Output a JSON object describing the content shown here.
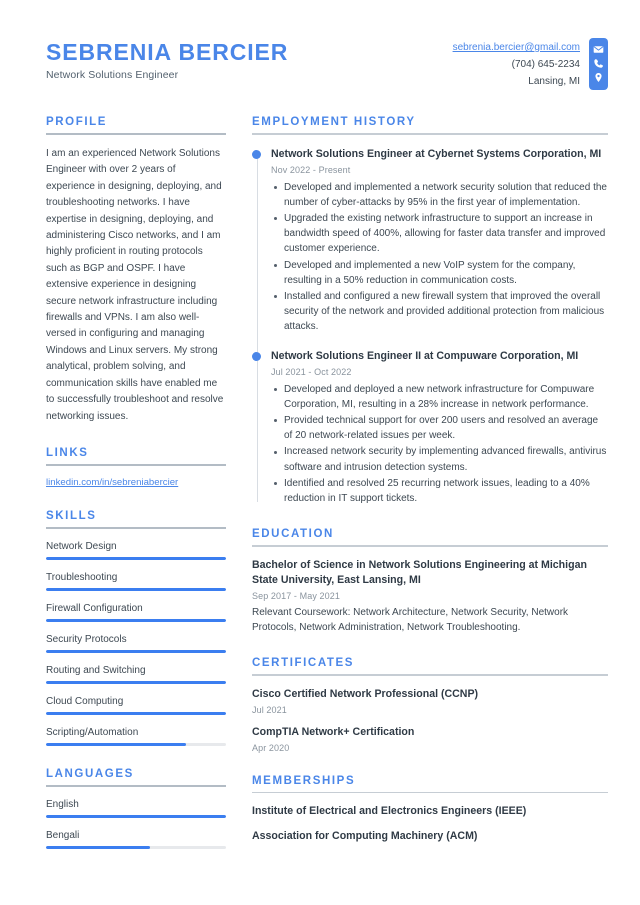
{
  "header": {
    "full_name": "SEBRENIA BERCIER",
    "job_title": "Network Solutions Engineer",
    "email": "sebrenia.bercier@gmail.com",
    "phone": "(704) 645-2234",
    "location": "Lansing, MI",
    "icons": [
      "envelope-icon",
      "phone-icon",
      "map-pin-icon"
    ],
    "accent_color": "#4a86e8"
  },
  "sidebar": {
    "profile": {
      "title": "Profile",
      "text": "I am an experienced Network Solutions Engineer with over 2 years of experience in designing, deploying, and troubleshooting networks. I have expertise in designing, deploying, and administering Cisco networks, and I am highly proficient in routing protocols such as BGP and OSPF. I have extensive experience in designing secure network infrastructure including firewalls and VPNs. I am also well-versed in configuring and managing Windows and Linux servers. My strong analytical, problem solving, and communication skills have enabled me to successfully troubleshoot and resolve networking issues."
    },
    "links": {
      "title": "Links",
      "items": [
        {
          "label": "linkedin.com/in/sebreniabercier"
        }
      ]
    },
    "skills": {
      "title": "Skills",
      "items": [
        {
          "label": "Network Design",
          "level": 100
        },
        {
          "label": "Troubleshooting",
          "level": 100
        },
        {
          "label": "Firewall Configuration",
          "level": 100
        },
        {
          "label": "Security Protocols",
          "level": 100
        },
        {
          "label": "Routing and Switching",
          "level": 100
        },
        {
          "label": "Cloud Computing",
          "level": 100
        },
        {
          "label": "Scripting/Automation",
          "level": 78
        }
      ]
    },
    "languages": {
      "title": "Languages",
      "items": [
        {
          "label": "English",
          "level": 100
        },
        {
          "label": "Bengali",
          "level": 58
        }
      ]
    }
  },
  "main": {
    "employment": {
      "title": "Employment History",
      "items": [
        {
          "title": "Network Solutions Engineer at Cybernet Systems Corporation, MI",
          "date": "Nov 2022 - Present",
          "bullets": [
            "Developed and implemented a network security solution that reduced the number of cyber-attacks by 95% in the first year of implementation.",
            "Upgraded the existing network infrastructure to support an increase in bandwidth speed of 400%, allowing for faster data transfer and improved customer experience.",
            "Developed and implemented a new VoIP system for the company, resulting in a 50% reduction in communication costs.",
            "Installed and configured a new firewall system that improved the overall security of the network and provided additional protection from malicious attacks."
          ]
        },
        {
          "title": "Network Solutions Engineer II at Compuware Corporation, MI",
          "date": "Jul 2021 - Oct 2022",
          "bullets": [
            "Developed and deployed a new network infrastructure for Compuware Corporation, MI, resulting in a 28% increase in network performance.",
            "Provided technical support for over 200 users and resolved an average of 20 network-related issues per week.",
            "Increased network security by implementing advanced firewalls, antivirus software and intrusion detection systems.",
            "Identified and resolved 25 recurring network issues, leading to a 40% reduction in IT support tickets."
          ]
        }
      ]
    },
    "education": {
      "title": "Education",
      "items": [
        {
          "title": "Bachelor of Science in Network Solutions Engineering at Michigan State University, East Lansing, MI",
          "date": "Sep 2017 - May 2021",
          "description": "Relevant Coursework: Network Architecture, Network Security, Network Protocols, Network Administration, Network Troubleshooting."
        }
      ]
    },
    "certificates": {
      "title": "Certificates",
      "items": [
        {
          "title": "Cisco Certified Network Professional (CCNP)",
          "date": "Jul 2021"
        },
        {
          "title": "CompTIA Network+ Certification",
          "date": "Apr 2020"
        }
      ]
    },
    "memberships": {
      "title": "Memberships",
      "items": [
        {
          "title": "Institute of Electrical and Electronics Engineers (IEEE)"
        },
        {
          "title": "Association for Computing Machinery (ACM)"
        }
      ]
    }
  }
}
